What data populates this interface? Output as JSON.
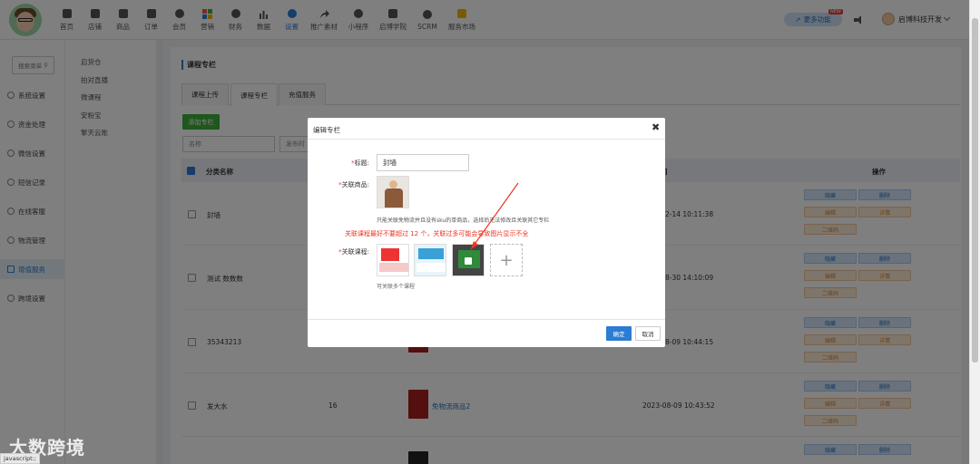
{
  "nav": {
    "items": [
      {
        "label": "首页",
        "icon": "home-icon"
      },
      {
        "label": "店铺",
        "icon": "store-icon"
      },
      {
        "label": "商品",
        "icon": "product-icon"
      },
      {
        "label": "订单",
        "icon": "order-icon"
      },
      {
        "label": "会员",
        "icon": "member-icon"
      },
      {
        "label": "营销",
        "icon": "marketing-icon"
      },
      {
        "label": "财务",
        "icon": "finance-icon"
      },
      {
        "label": "数据",
        "icon": "data-icon"
      },
      {
        "label": "设置",
        "icon": "settings-icon",
        "active": true
      },
      {
        "label": "推广素材",
        "icon": "share-icon"
      },
      {
        "label": "小程序",
        "icon": "miniapp-icon"
      },
      {
        "label": "启博学院",
        "icon": "academy-icon"
      },
      {
        "label": "SCRM",
        "icon": "scrm-icon"
      },
      {
        "label": "服务市场",
        "icon": "market-icon"
      }
    ],
    "more_label": "更多功能",
    "new_badge": "NEW",
    "user_name": "启博科技开发"
  },
  "sidebar": {
    "search_label": "搜索菜单",
    "items": [
      {
        "label": "系统设置"
      },
      {
        "label": "资金处理"
      },
      {
        "label": "微信设置"
      },
      {
        "label": "短信记录"
      },
      {
        "label": "在线客服"
      },
      {
        "label": "物流管理"
      },
      {
        "label": "增值服务",
        "active": true
      },
      {
        "label": "跨境设置"
      }
    ],
    "sub_items": [
      "启货仓",
      "拍对直播",
      "微课程",
      "安粉宝",
      "擎天云账"
    ]
  },
  "main": {
    "title": "课程专栏",
    "tabs": [
      "课程上传",
      "课程专栏",
      "充值服务"
    ],
    "active_tab": 1,
    "add_button": "添加专栏",
    "filter_name_placeholder": "名称",
    "filter_time_placeholder": "发布时",
    "columns": {
      "name": "分类名称",
      "time": "间",
      "ops": "操作"
    },
    "ops": {
      "hide": "隐藏",
      "delete": "删除",
      "edit": "编辑",
      "detail": "详情",
      "qrcode": "二维码"
    },
    "rows": [
      {
        "name": "封墙",
        "count": "",
        "product": "",
        "time": "2-14 10:11:38"
      },
      {
        "name": "测试 数数数",
        "count": "",
        "product": "",
        "time": "8-30 14:10:09"
      },
      {
        "name": "35343213",
        "count": "",
        "product": "",
        "time": "8-09 10:44:15"
      },
      {
        "name": "发大水",
        "count": "16",
        "product": "免物流商品2",
        "time": "2023-08-09 10:43:52"
      }
    ]
  },
  "modal": {
    "title": "编辑专栏",
    "close": "✖",
    "title_label": "标题:",
    "title_value": "封墙",
    "product_label": "关联商品:",
    "product_help": "只能关联免物流并且没有sku的单商品，选择后无法修改且关联其它专栏",
    "warning": "关联课程最好不要超过 12 个，关联过多可能会导致图片显示不全",
    "courses_label": "关联课程:",
    "courses_help": "可关联多个课程",
    "add_symbol": "+",
    "ok_label": "确定",
    "cancel_label": "取消"
  },
  "watermark": "大数跨境",
  "status_text": "javascript:;"
}
